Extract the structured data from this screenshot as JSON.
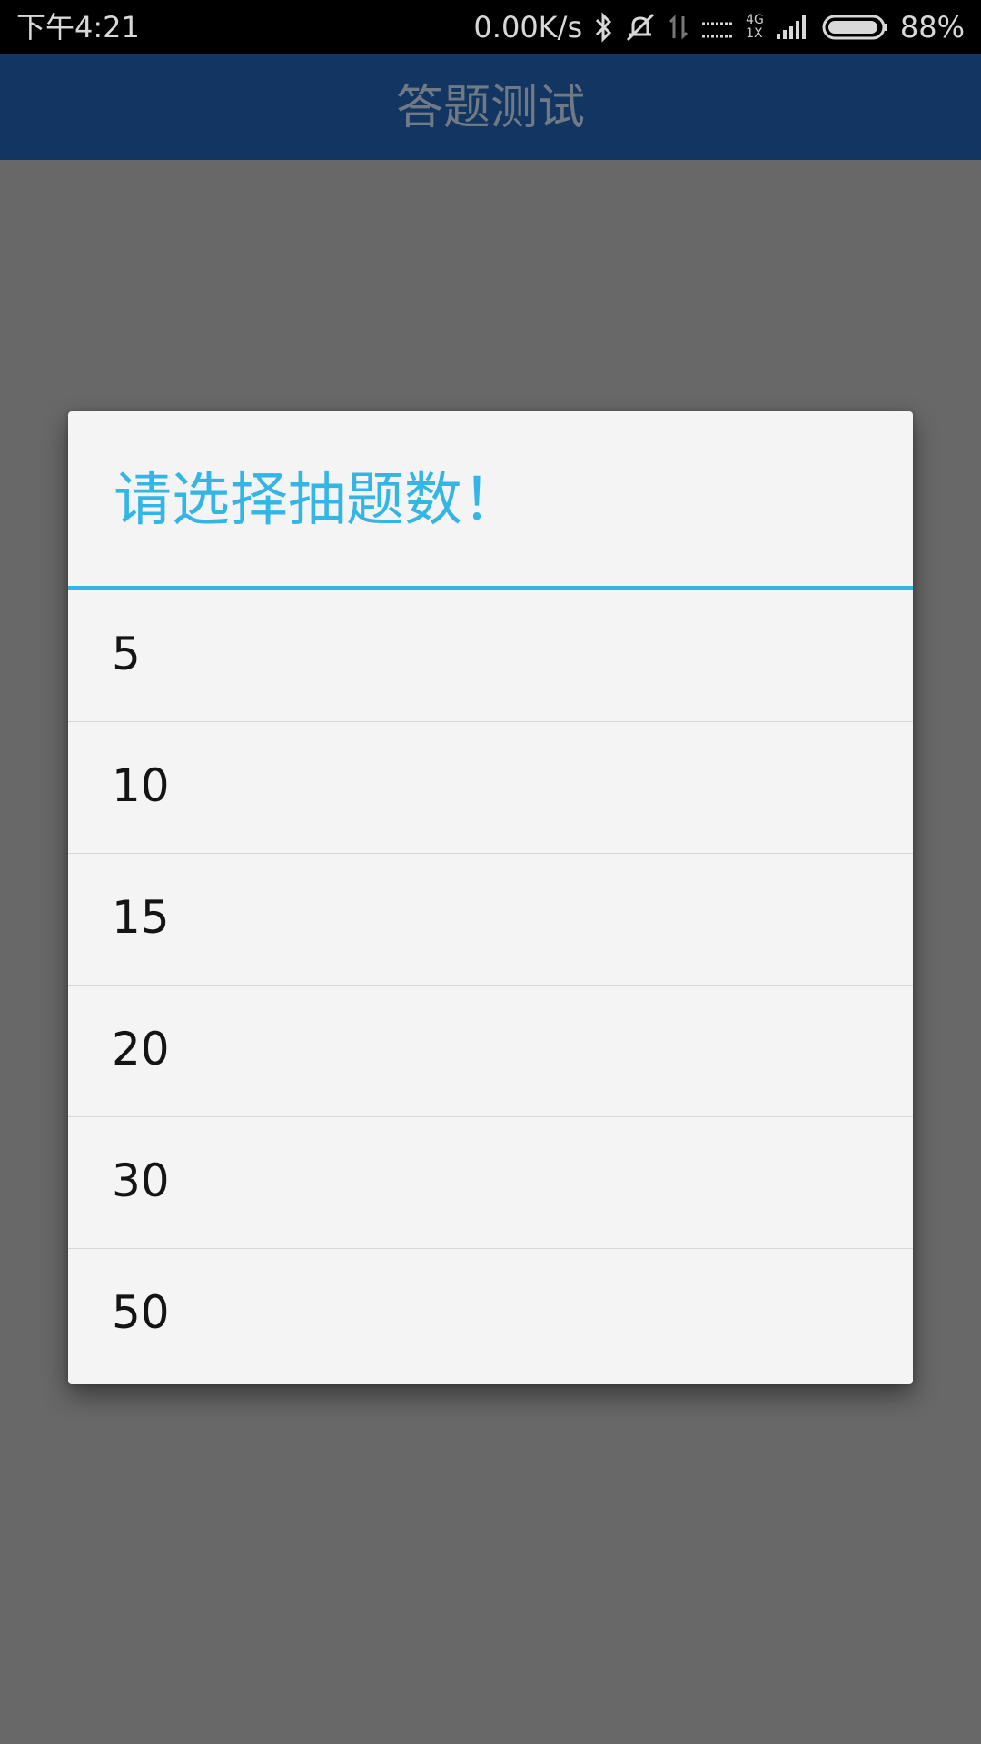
{
  "status_bar": {
    "time": "下午4:21",
    "net_speed": "0.00K/s",
    "net_type_top": "4G",
    "net_type_bottom": "1X",
    "battery_percent": "88%",
    "icons": [
      "bluetooth-icon",
      "silent-icon",
      "data-arrows-icon",
      "signal-bars-icon",
      "signal-bars-2-icon",
      "battery-icon"
    ],
    "battery_level": 0.88
  },
  "app_bar": {
    "title": "答题测试"
  },
  "dialog": {
    "title": "请选择抽题数！",
    "accent_color": "#33b5e5",
    "options": [
      {
        "label": "5"
      },
      {
        "label": "10"
      },
      {
        "label": "15"
      },
      {
        "label": "20"
      },
      {
        "label": "30"
      },
      {
        "label": "50"
      }
    ]
  },
  "colors": {
    "status_bar_bg": "#000000",
    "app_bar_bg": "#133561",
    "scrim_bg": "#686868",
    "dialog_bg": "#f4f4f4"
  }
}
